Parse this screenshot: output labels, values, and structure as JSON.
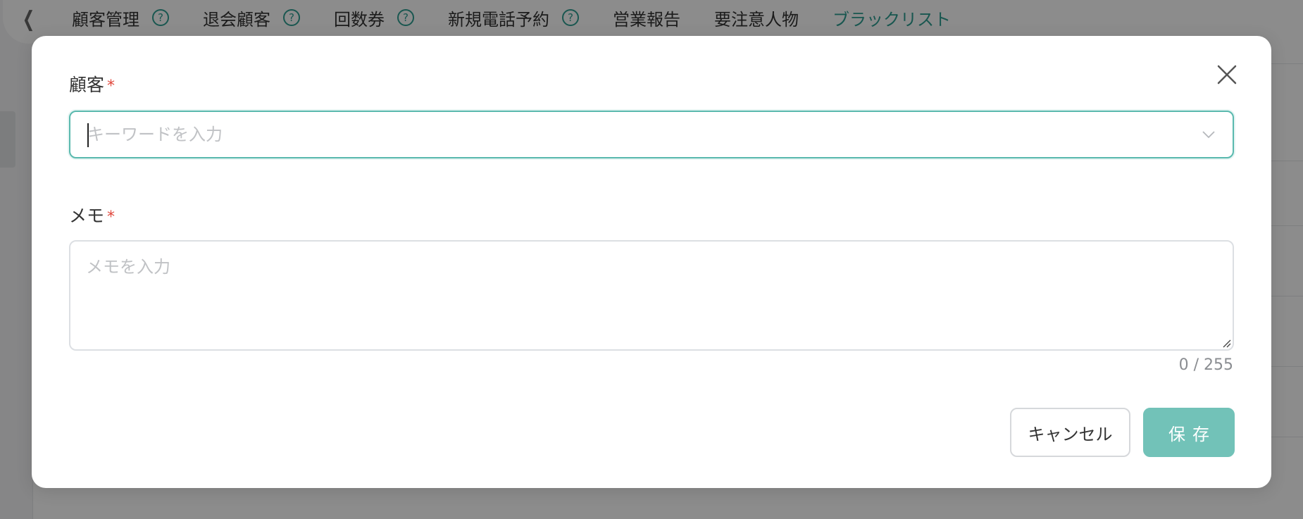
{
  "background": {
    "back_icon": "chevron-left-icon",
    "tabs": [
      {
        "label": "顧客管理",
        "help": true
      },
      {
        "label": "退会顧客",
        "help": true
      },
      {
        "label": "回数券",
        "help": true
      },
      {
        "label": "新規電話予約",
        "help": true
      },
      {
        "label": "営業報告",
        "help": false
      },
      {
        "label": "要注意人物",
        "help": false
      },
      {
        "label": "ブラックリスト",
        "help": false,
        "active": true
      }
    ],
    "help_glyph": "?"
  },
  "modal": {
    "customer": {
      "label": "顧客",
      "required_mark": "*",
      "placeholder": "キーワードを入力",
      "value": ""
    },
    "memo": {
      "label": "メモ",
      "required_mark": "*",
      "placeholder": "メモを入力",
      "value": "",
      "counter": "0 / 255"
    },
    "buttons": {
      "cancel_label": "キャンセル",
      "save_label": "保存"
    }
  },
  "colors": {
    "accent": "#2f9e92",
    "focus_border": "#5ab9ae",
    "save_button": "#72c2b8",
    "required": "#e0473c",
    "overlay": "rgba(0,0,0,0.45)"
  }
}
